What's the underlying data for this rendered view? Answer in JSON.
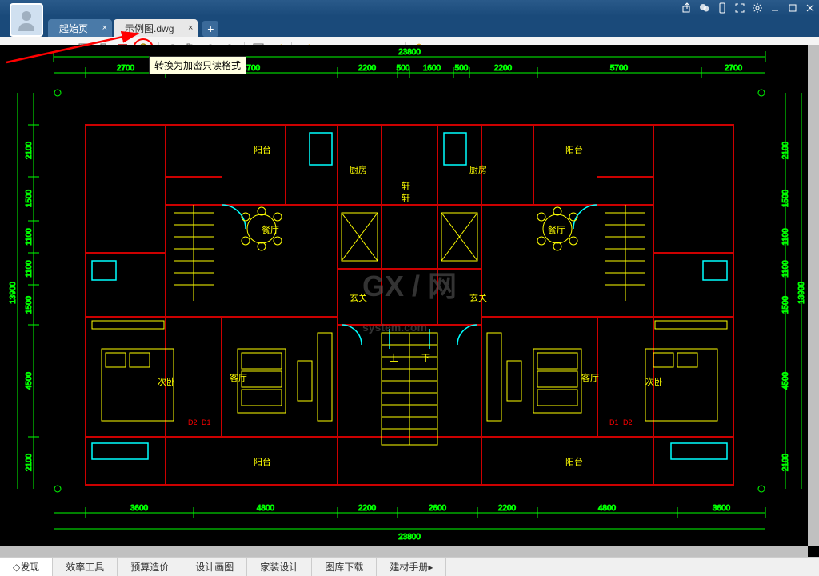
{
  "tabs": {
    "start": "起始页",
    "file": "示例图.dwg"
  },
  "tooltip": "转换为加密只读格式",
  "bottom_tabs": {
    "discover": "发现",
    "efficiency": "效率工具",
    "budget": "预算造价",
    "design": "设计画图",
    "home": "家装设计",
    "library": "图库下载",
    "material": "建材手册"
  },
  "rooms": {
    "balcony": "阳台",
    "kitchen": "厨房",
    "dining": "餐厅",
    "entrance": "玄关",
    "living": "客厅",
    "bedroom2": "次卧",
    "up": "上",
    "down": "下"
  },
  "dims": {
    "total_w": "23800",
    "w1": "2700",
    "w2": "5700",
    "w3": "2200",
    "w4": "500",
    "w5": "1600",
    "w6": "500",
    "total_h": "13900",
    "h1": "2100",
    "h2": "1500",
    "h3": "1100",
    "h4": "1100",
    "h5": "1500",
    "h6": "4500",
    "h7": "2100",
    "bw1": "3600",
    "bw2": "4800",
    "bw3": "2200",
    "bw4": "2600"
  },
  "labels": {
    "d1": "D1",
    "d2": "D2",
    "s": "轩"
  },
  "watermark": "GX / 网",
  "watermark_sub": "system.com"
}
